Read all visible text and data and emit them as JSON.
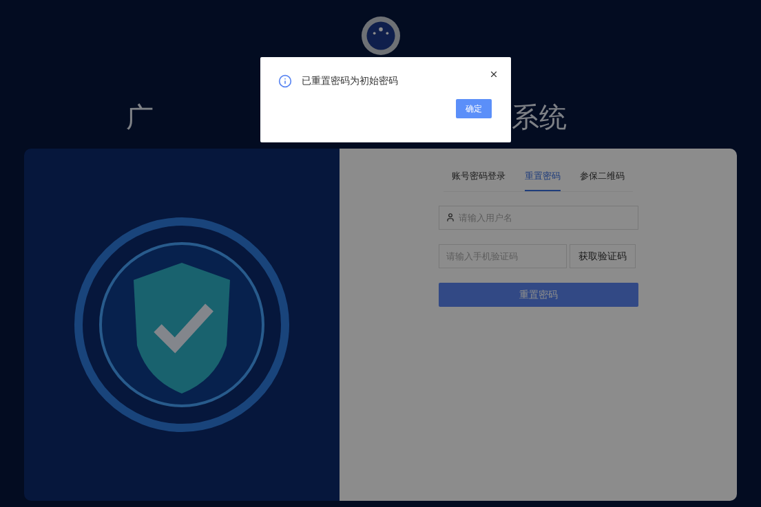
{
  "page": {
    "title_left": "广",
    "title_right": "系统"
  },
  "login_panel": {
    "tabs": [
      {
        "label": "账号密码登录",
        "selected": false
      },
      {
        "label": "重置密码",
        "selected": true
      },
      {
        "label": "参保二维码",
        "selected": false
      }
    ],
    "username": {
      "placeholder": "请输入用户名"
    },
    "sms_code": {
      "placeholder": "请输入手机验证码"
    },
    "get_code_button": "获取验证码",
    "submit_button": "重置密码"
  },
  "dialog": {
    "message": "已重置密码为初始密码",
    "ok_button": "确定"
  }
}
